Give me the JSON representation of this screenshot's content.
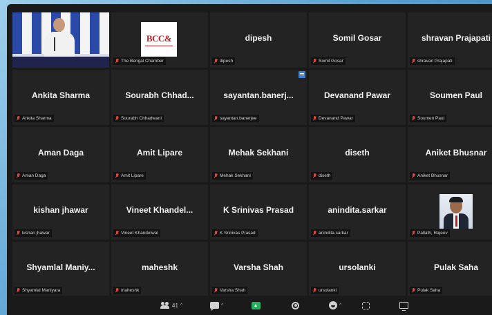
{
  "tiles": [
    {
      "display": "",
      "label": "",
      "type": "video"
    },
    {
      "display": "",
      "label": "The Bengal Chamber",
      "type": "logo",
      "logo_text": "BCC&"
    },
    {
      "display": "dipesh",
      "label": "dipesh"
    },
    {
      "display": "Somil Gosar",
      "label": "Somil Gosar"
    },
    {
      "display": "shravan Prajapati",
      "label": "shravan Prajapati"
    },
    {
      "display": "Ankita Sharma",
      "label": "Ankita Sharma"
    },
    {
      "display": "Sourabh Chhad...",
      "label": "Sourabh Chhadwani"
    },
    {
      "display": "sayantan.banerj...",
      "label": "sayantan.banerjee"
    },
    {
      "display": "Devanand Pawar",
      "label": "Devanand Pawar"
    },
    {
      "display": "Soumen Paul",
      "label": "Soumen Paul"
    },
    {
      "display": "Aman Daga",
      "label": "Aman Daga"
    },
    {
      "display": "Amit Lipare",
      "label": "Amit Lipare"
    },
    {
      "display": "Mehak Sekhani",
      "label": "Mehak Sekhani"
    },
    {
      "display": "diseth",
      "label": "diseth"
    },
    {
      "display": "Aniket Bhusnar",
      "label": "Aniket Bhusnar"
    },
    {
      "display": "kishan jhawar",
      "label": "kishan jhawar"
    },
    {
      "display": "Vineet Khandel...",
      "label": "Vineet Khandelwal"
    },
    {
      "display": "K Srinivas Prasad",
      "label": "K Srinivas Prasad"
    },
    {
      "display": "anindita.sarkar",
      "label": "anindita.sarkar"
    },
    {
      "display": "",
      "label": "Pallath, Rajeev",
      "type": "photo"
    },
    {
      "display": "Shyamlal Maniy...",
      "label": "Shyamlal Maniyara"
    },
    {
      "display": "maheshk",
      "label": "maheshk"
    },
    {
      "display": "Varsha Shah",
      "label": "Varsha Shah"
    },
    {
      "display": "ursolanki",
      "label": "ursolanki"
    },
    {
      "display": "Pulak Saha",
      "label": "Pulak Saha"
    }
  ],
  "toolbar": {
    "participants_count": "41",
    "caret": "^"
  },
  "colors": {
    "background": "#1a1a1a",
    "tile": "#232323",
    "active_speaker": "#d9d52a",
    "mic_muted": "#e0463a",
    "share_green": "#23b05f"
  }
}
